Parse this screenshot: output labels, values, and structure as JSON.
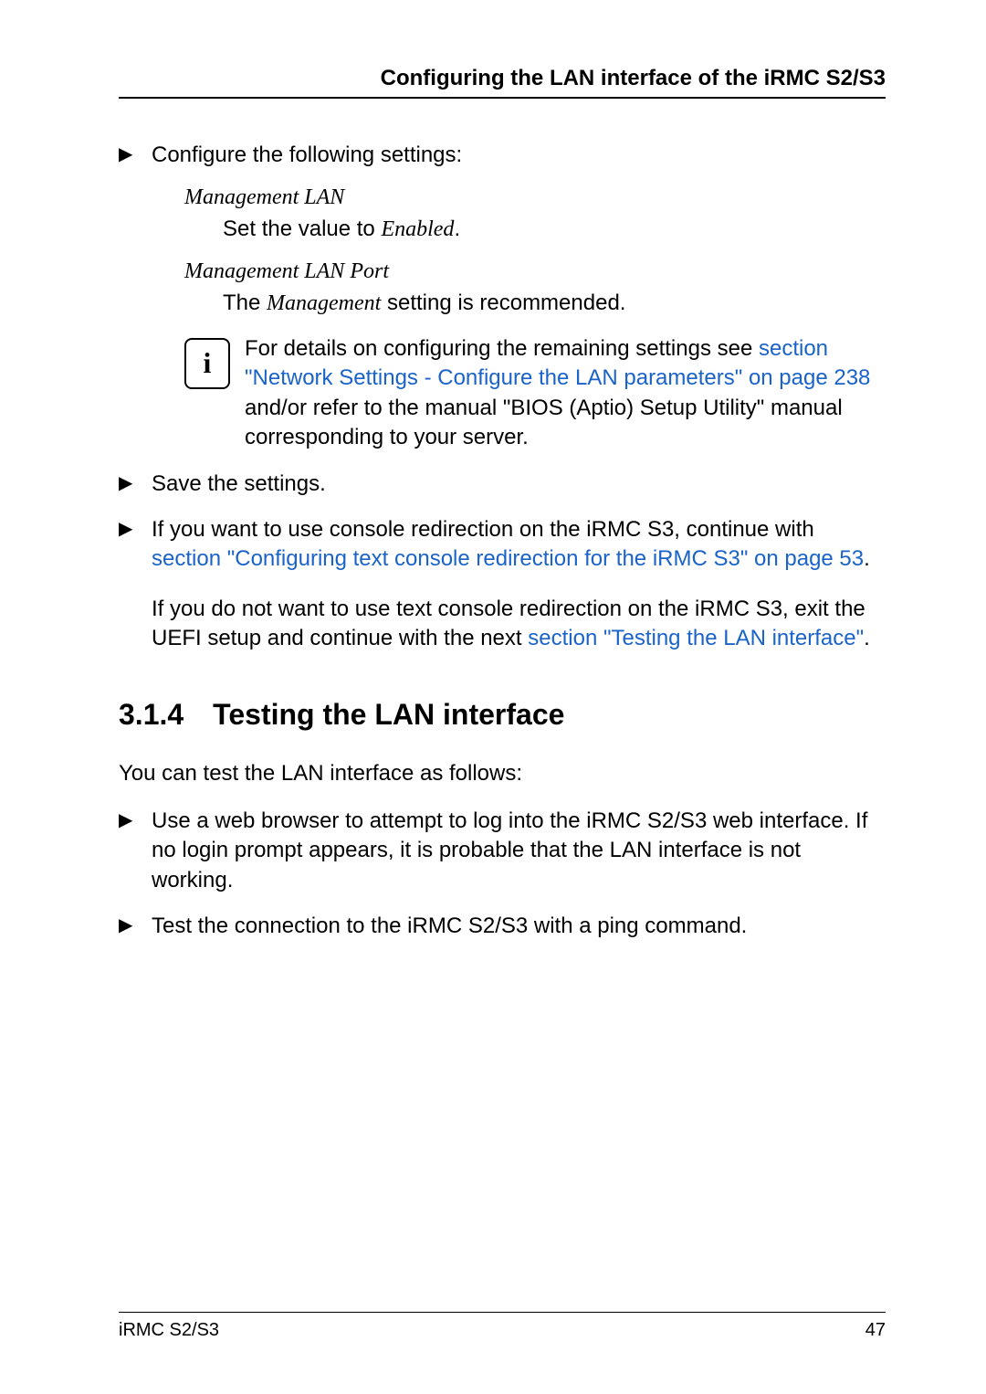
{
  "header": {
    "running_head": "Configuring the LAN interface of the iRMC S2/S3"
  },
  "content": {
    "bullet1_text": "Configure the following settings:",
    "mgmt_lan": {
      "title": "Management LAN",
      "desc_prefix": "Set the value to ",
      "desc_em": "Enabled",
      "desc_suffix": "."
    },
    "mgmt_lan_port": {
      "title": "Management LAN Port",
      "desc_prefix": "The ",
      "desc_em": "Management",
      "desc_suffix": " setting is recommended."
    },
    "info": {
      "line1_prefix": "For details on configuring the remaining settings see ",
      "line1_link": "section \"Network Settings - Configure the LAN parameters\" on page 238",
      "line2": " and/or refer to the manual \"BIOS (Aptio) Setup Utility\" manual corresponding to your server."
    },
    "bullet2_text": "Save the settings.",
    "bullet3": {
      "prefix": "If you want to use console redirection on the iRMC S3, continue with ",
      "link": "section \"Configuring text console redirection for the iRMC S3\" on page 53",
      "suffix": "."
    },
    "para_after": {
      "prefix": "If you do not want to use text console redirection on the iRMC S3, exit the UEFI setup and continue with the next ",
      "link": "section \"Testing the LAN interface\"",
      "suffix": "."
    },
    "section": {
      "number": "3.1.4",
      "title": "Testing the LAN interface"
    },
    "section_intro": "You can test the LAN interface as follows:",
    "sec_bullet1": "Use a web browser to attempt to log into the iRMC S2/S3 web interface. If no login prompt appears, it is probable that the LAN interface is not working.",
    "sec_bullet2": "Test the connection to the iRMC S2/S3 with a ping command."
  },
  "footer": {
    "left": "iRMC S2/S3",
    "right": "47"
  },
  "glyphs": {
    "bullet": "▶",
    "info": "i"
  }
}
